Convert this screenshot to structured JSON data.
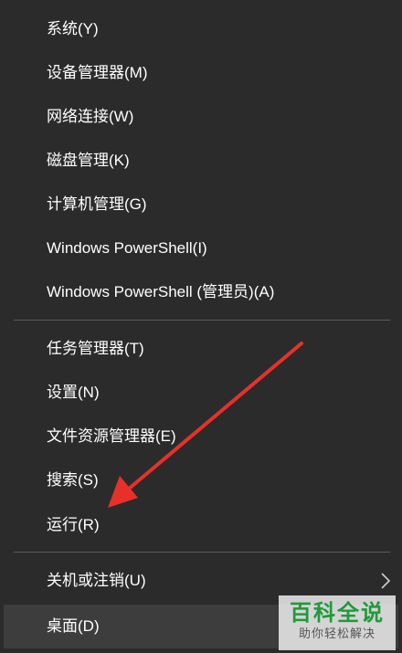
{
  "menu": {
    "items": [
      {
        "label": "系统(Y)"
      },
      {
        "label": "设备管理器(M)"
      },
      {
        "label": "网络连接(W)"
      },
      {
        "label": "磁盘管理(K)"
      },
      {
        "label": "计算机管理(G)"
      },
      {
        "label": "Windows PowerShell(I)"
      },
      {
        "label": "Windows PowerShell (管理员)(A)"
      },
      {
        "label": "任务管理器(T)"
      },
      {
        "label": "设置(N)"
      },
      {
        "label": "文件资源管理器(E)"
      },
      {
        "label": "搜索(S)"
      },
      {
        "label": "运行(R)"
      },
      {
        "label": "关机或注销(U)",
        "submenu_icon": "chevron-right-icon"
      },
      {
        "label": "桌面(D)",
        "highlighted": true
      }
    ]
  },
  "colors": {
    "background": "#2b2b2b",
    "text": "#ffffff",
    "highlight": "#3d3d3d",
    "divider": "#5a5a5a",
    "annotation_arrow": "#e8302a",
    "watermark_green": "#1f9a3a"
  },
  "annotation": {
    "icon": "red-arrow-icon",
    "target": "运行(R)"
  },
  "watermark": {
    "title": "百科全说",
    "subtitle": "助你轻松解决"
  }
}
